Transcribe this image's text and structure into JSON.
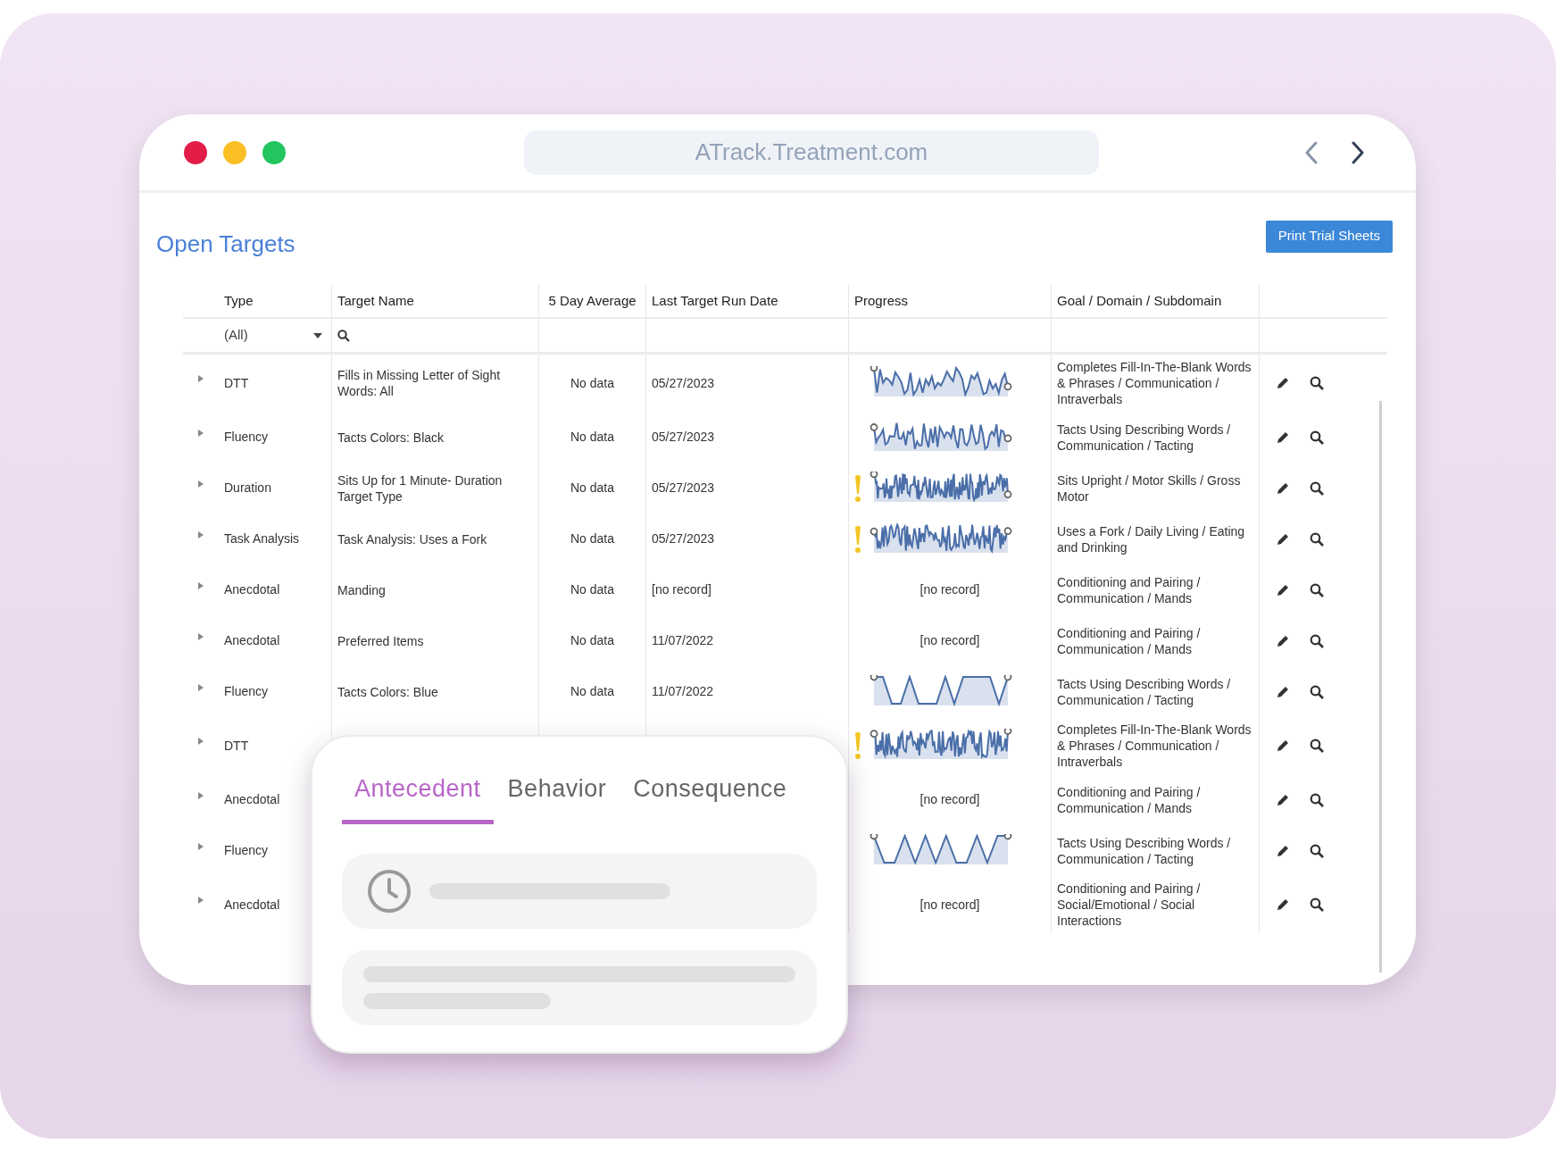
{
  "browser": {
    "url": "ATrack.Treatment.com"
  },
  "page": {
    "title": "Open Targets",
    "print_button": "Print Trial Sheets"
  },
  "table": {
    "columns": [
      "Type",
      "Target Name",
      "5 Day Average",
      "Last Target Run Date",
      "Progress",
      "Goal / Domain / Subdomain"
    ],
    "filters": {
      "type_value": "(All)"
    },
    "rows": [
      {
        "expanded": false,
        "type": "DTT",
        "target_name": "Fills in Missing Letter of Sight Words: All",
        "five_day_average": "No data",
        "last_run_date": "05/27/2023",
        "progress": {
          "kind": "sparkline",
          "alert": false
        },
        "goal": "Completes Fill-In-The-Blank Words & Phrases / Communication / Intraverbals"
      },
      {
        "expanded": false,
        "type": "Fluency",
        "target_name": "Tacts Colors: Black",
        "five_day_average": "No data",
        "last_run_date": "05/27/2023",
        "progress": {
          "kind": "sparkline",
          "alert": false
        },
        "goal": "Tacts Using Describing Words / Communication / Tacting"
      },
      {
        "expanded": false,
        "type": "Duration",
        "target_name": "Sits Up for 1 Minute- Duration Target Type",
        "five_day_average": "No data",
        "last_run_date": "05/27/2023",
        "progress": {
          "kind": "sparkline",
          "alert": true
        },
        "goal": "Sits Upright / Motor Skills / Gross Motor"
      },
      {
        "expanded": false,
        "type": "Task Analysis",
        "target_name": "Task Analysis: Uses a Fork",
        "five_day_average": "No data",
        "last_run_date": "05/27/2023",
        "progress": {
          "kind": "sparkline",
          "alert": true
        },
        "goal": "Uses a Fork / Daily Living / Eating and Drinking"
      },
      {
        "expanded": false,
        "type": "Anecdotal",
        "target_name": "Manding",
        "five_day_average": "No data",
        "last_run_date": "[no record]",
        "progress": {
          "kind": "text",
          "text": "[no record]"
        },
        "goal": "Conditioning and Pairing / Communication / Mands"
      },
      {
        "expanded": false,
        "type": "Anecdotal",
        "target_name": "Preferred Items",
        "five_day_average": "No data",
        "last_run_date": "11/07/2022",
        "progress": {
          "kind": "text",
          "text": "[no record]"
        },
        "goal": "Conditioning and Pairing / Communication / Mands"
      },
      {
        "expanded": false,
        "type": "Fluency",
        "target_name": "Tacts Colors: Blue",
        "five_day_average": "No data",
        "last_run_date": "11/07/2022",
        "progress": {
          "kind": "sparkline",
          "alert": false
        },
        "goal": "Tacts Using Describing Words / Communication / Tacting"
      },
      {
        "expanded": false,
        "type": "DTT",
        "progress": {
          "kind": "sparkline",
          "alert": true
        },
        "goal": "Completes Fill-In-The-Blank Words & Phrases / Communication / Intraverbals"
      },
      {
        "expanded": false,
        "type": "Anecdotal",
        "progress": {
          "kind": "text",
          "text": "[no record]"
        },
        "goal": "Conditioning and Pairing / Communication / Mands"
      },
      {
        "expanded": false,
        "type": "Fluency",
        "progress": {
          "kind": "sparkline",
          "alert": false
        },
        "goal": "Tacts Using Describing Words / Communication / Tacting"
      },
      {
        "expanded": false,
        "type": "Anecdotal",
        "progress": {
          "kind": "text",
          "text": "[no record]"
        },
        "goal": "Conditioning and Pairing / Social/Emotional / Social Interactions"
      }
    ]
  },
  "popup": {
    "tabs": [
      {
        "label": "Antecedent",
        "selected": true
      },
      {
        "label": "Behavior",
        "selected": false
      },
      {
        "label": "Consequence",
        "selected": false
      }
    ]
  }
}
